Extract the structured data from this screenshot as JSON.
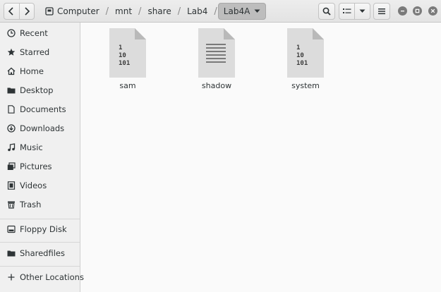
{
  "breadcrumb": [
    "Computer",
    "mnt",
    "share",
    "Lab4",
    "Lab4A"
  ],
  "sidebar": {
    "items": [
      {
        "label": "Recent",
        "icon": "clock-icon"
      },
      {
        "label": "Starred",
        "icon": "star-icon"
      },
      {
        "label": "Home",
        "icon": "home-icon"
      },
      {
        "label": "Desktop",
        "icon": "desktop-icon"
      },
      {
        "label": "Documents",
        "icon": "document-icon"
      },
      {
        "label": "Downloads",
        "icon": "download-icon"
      },
      {
        "label": "Music",
        "icon": "music-icon"
      },
      {
        "label": "Pictures",
        "icon": "pictures-icon"
      },
      {
        "label": "Videos",
        "icon": "video-icon"
      },
      {
        "label": "Trash",
        "icon": "trash-icon"
      },
      {
        "label": "Floppy Disk",
        "icon": "drive-icon"
      },
      {
        "label": "Sharedfiles",
        "icon": "folder-icon"
      },
      {
        "label": "Other Locations",
        "icon": "plus-icon"
      }
    ]
  },
  "files": [
    {
      "name": "sam",
      "icon": "binary-file-icon"
    },
    {
      "name": "shadow",
      "icon": "text-file-icon"
    },
    {
      "name": "system",
      "icon": "binary-file-icon"
    }
  ],
  "binary_glyph": [
    "1",
    "10",
    "101"
  ]
}
